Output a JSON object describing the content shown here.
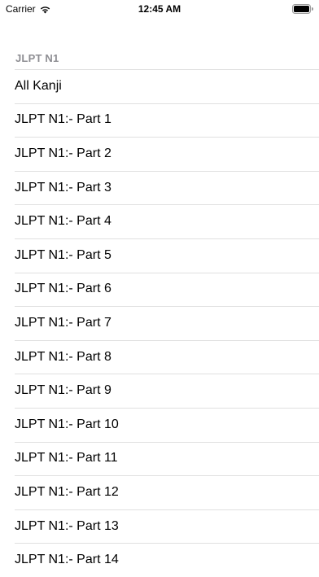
{
  "status_bar": {
    "carrier": "Carrier",
    "time": "12:45 AM",
    "wifi_icon": "wifi-icon",
    "battery_icon": "battery-icon"
  },
  "section": {
    "header": "JLPT N1"
  },
  "rows": [
    {
      "label": "All Kanji"
    },
    {
      "label": "JLPT N1:- Part 1"
    },
    {
      "label": "JLPT N1:- Part 2"
    },
    {
      "label": "JLPT N1:- Part 3"
    },
    {
      "label": "JLPT N1:- Part 4"
    },
    {
      "label": "JLPT N1:- Part 5"
    },
    {
      "label": "JLPT N1:- Part 6"
    },
    {
      "label": "JLPT N1:- Part 7"
    },
    {
      "label": "JLPT N1:- Part 8"
    },
    {
      "label": "JLPT N1:- Part 9"
    },
    {
      "label": "JLPT N1:- Part 10"
    },
    {
      "label": "JLPT N1:- Part 11"
    },
    {
      "label": "JLPT N1:- Part 12"
    },
    {
      "label": "JLPT N1:- Part 13"
    },
    {
      "label": "JLPT N1:- Part 14"
    }
  ],
  "colors": {
    "header_text": "#8e8e93",
    "separator": "#e0e0e0",
    "background": "#ffffff"
  }
}
